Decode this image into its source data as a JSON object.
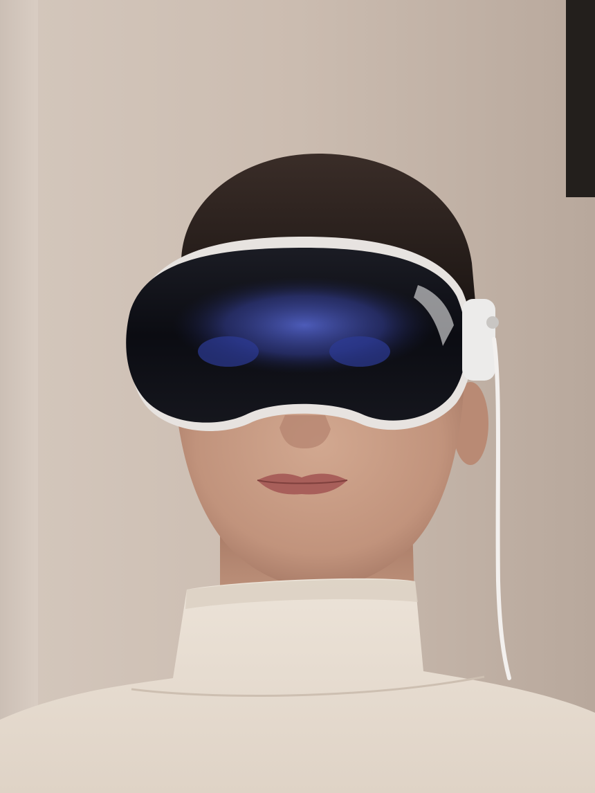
{
  "image": {
    "subject": "person-wearing-vr-headset",
    "palette": {
      "wall": "#c8b9ad",
      "wall_shadow": "#a8998e",
      "skin": "#c99d86",
      "skin_shadow": "#a97b66",
      "hair": "#241c19",
      "visor_glass": "#0c0d14",
      "visor_glow": "#4b5cd0",
      "headset_frame": "#e9e6e4",
      "sweater": "#e9dfd3",
      "cable": "#f1eeec",
      "frame_on_wall": "#231f1c"
    }
  }
}
